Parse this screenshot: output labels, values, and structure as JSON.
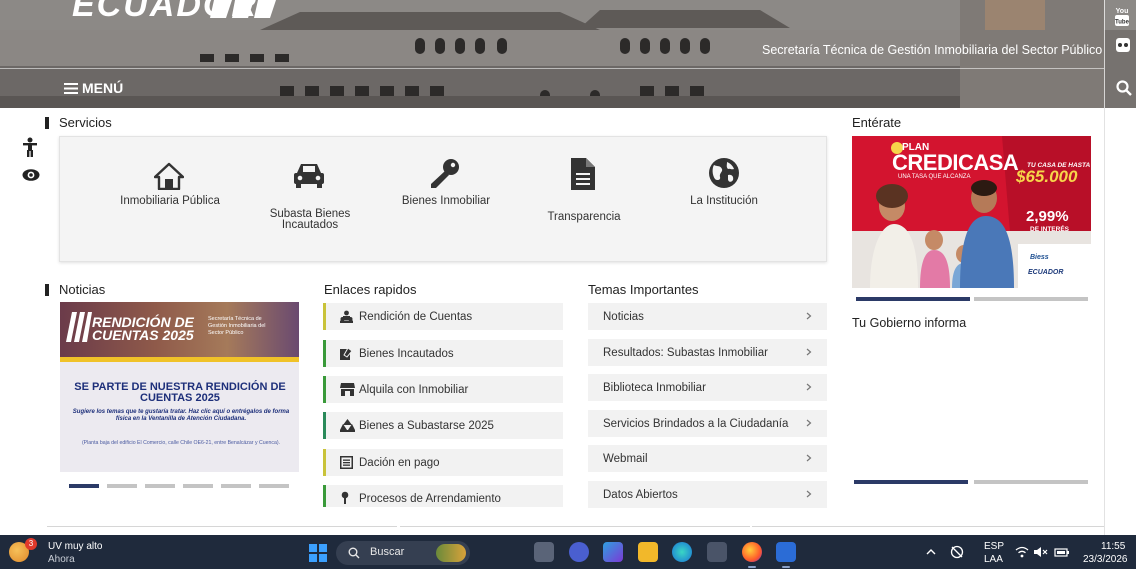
{
  "header": {
    "logo_text": "ECUADOR",
    "subtitle": "Secretaría Técnica de Gestión Inmobiliaria del Sector Público",
    "menu_label": "MENÚ",
    "youtube_label_top": "You",
    "youtube_label_bottom": "Tube"
  },
  "services": {
    "title": "Servicios",
    "items": [
      {
        "label": "Inmobiliaria Pública",
        "icon": "home-icon"
      },
      {
        "label": "Subasta Bienes Incautados",
        "icon": "car-icon"
      },
      {
        "label": "Bienes Inmobiliar",
        "icon": "key-icon"
      },
      {
        "label": "Transparencia",
        "icon": "document-icon"
      },
      {
        "label": "La Institución",
        "icon": "globe-icon"
      }
    ]
  },
  "enterate": {
    "title": "Entérate",
    "ad": {
      "plan": "PLAN",
      "brand": "CREDICASA",
      "tagline": "UNA TASA QUE ALCANZA",
      "casa_hasta": "TU CASA DE HASTA",
      "amount": "$65.000",
      "rate": "2,99%",
      "rate_label": "DE INTERÉS",
      "biess": "Biess",
      "ecuador": "ECUADOR"
    }
  },
  "noticias": {
    "title": "Noticias",
    "banner": {
      "headline_top": "RENDICIÓN DE",
      "headline_bottom": "CUENTAS 2025",
      "secretaria": "Secretaría Técnica de Gestión Inmobiliaria del Sector Público",
      "heading": "SE PARTE DE NUESTRA RENDICIÓN DE CUENTAS 2025",
      "body": "Sugiere los temas que te gustaría tratar. Haz clic aquí o entrégalos de forma física en la Ventanilla de Atención Ciudadana.",
      "address": "(Planta baja del edificio El Comercio, calle Chile OE6-21, entre Benalcázar y Cuenca)."
    }
  },
  "enlaces": {
    "title": "Enlaces rapidos",
    "items": [
      {
        "label": "Rendición de Cuentas",
        "icon": "people-icon",
        "color": "#c9c33a"
      },
      {
        "label": "Bienes Incautados",
        "icon": "gavel-icon",
        "color": "#3a9a3a"
      },
      {
        "label": "Alquila con Inmobiliar",
        "icon": "store-icon",
        "color": "#3a9a3a"
      },
      {
        "label": "Bienes a Subastarse 2025",
        "icon": "group-icon",
        "color": "#2a8a5a"
      },
      {
        "label": "Dación en pago",
        "icon": "list-icon",
        "color": "#c9c33a"
      },
      {
        "label": "Procesos de Arrendamiento",
        "icon": "pin-icon",
        "color": "#3a9a3a"
      }
    ]
  },
  "temas": {
    "title": "Temas Importantes",
    "items": [
      {
        "label": "Noticias"
      },
      {
        "label": "Resultados: Subastas Inmobiliar"
      },
      {
        "label": "Biblioteca Inmobiliar"
      },
      {
        "label": "Servicios Brindados a la Ciudadanía"
      },
      {
        "label": "Webmail"
      },
      {
        "label": "Datos Abiertos"
      }
    ]
  },
  "gobierno": {
    "title": "Tu Gobierno informa"
  },
  "colors": {
    "carousel_active": "#2b3a67",
    "carousel_inactive": "#c4c4c4",
    "taskbar_bg": "#1f2a3c"
  },
  "taskbar": {
    "weather_badge": "3",
    "weather_title": "UV muy alto",
    "weather_sub": "Ahora",
    "search_label": "Buscar",
    "lang_top": "ESP",
    "lang_bottom": "LAA",
    "time": "11:55",
    "date": "23/3/2026"
  }
}
